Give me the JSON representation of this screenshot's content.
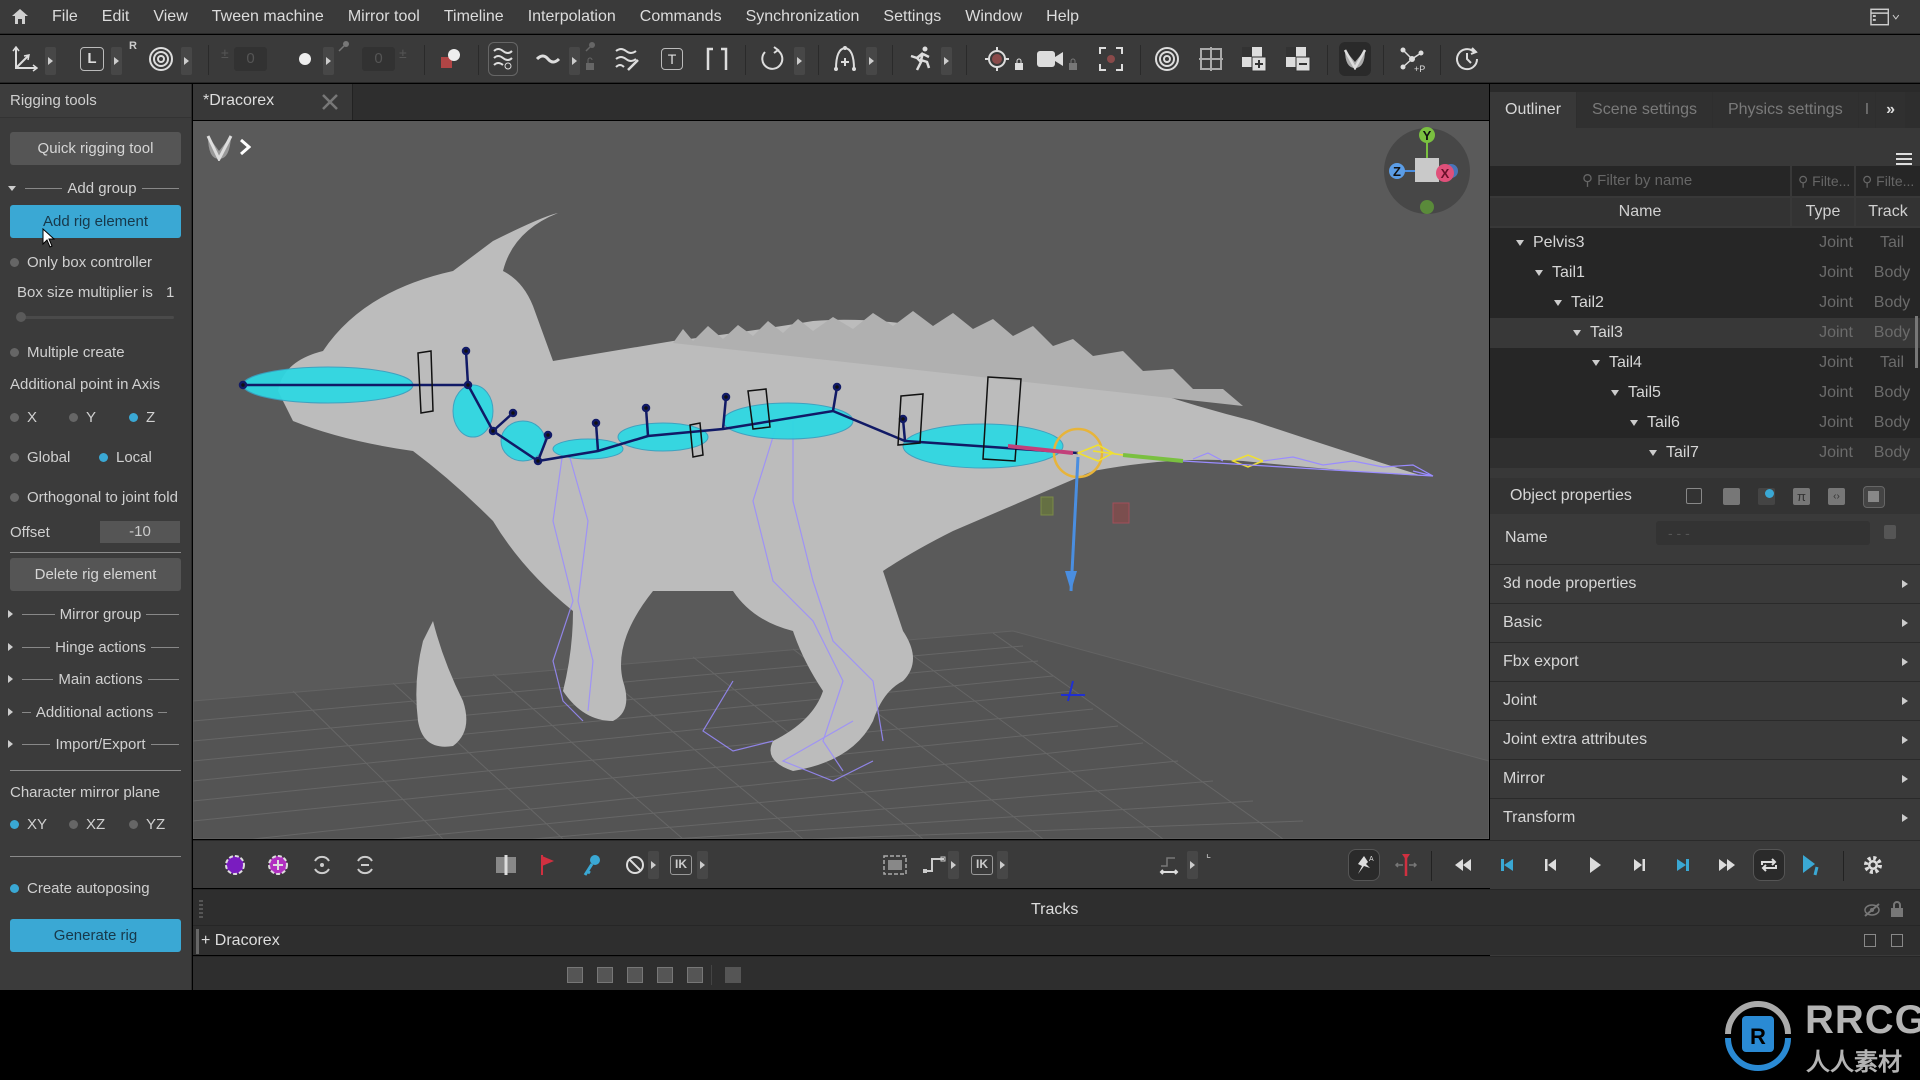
{
  "menubar": {
    "items": [
      "File",
      "Edit",
      "View",
      "Tween machine",
      "Mirror tool",
      "Timeline",
      "Interpolation",
      "Commands",
      "Synchronization",
      "Settings",
      "Window",
      "Help"
    ]
  },
  "toolbar": {
    "icons": [
      "axes-icon",
      "local-space-icon",
      "spiral-icon",
      "number-box",
      "dot-icon",
      "pin-icon",
      "number-box",
      "shapes-icon",
      "curves-icon",
      "wave-icon",
      "curves-edit-icon",
      "text-icon",
      "brackets-icon",
      "rotate-icon",
      "path-add-icon",
      "running-man-icon",
      "target-icon",
      "camera-icon",
      "frame-icon",
      "spiral-2-icon",
      "grid-icon",
      "layer-add-icon",
      "layer-remove-icon",
      "app-logo-icon",
      "nodes-icon",
      "history-icon"
    ],
    "local_label": "L",
    "r_label": "R",
    "num_left": "0",
    "num_right": "0"
  },
  "left_panel": {
    "title": "Rigging tools",
    "quick_rigging_tool": "Quick rigging tool",
    "add_group": "Add group",
    "add_rig_element": "Add rig element",
    "only_box_controller": "Only box controller",
    "box_size_label": "Box size multiplier is",
    "box_size_value": "1",
    "box_size_slider_fraction": 0.0,
    "multiple_create": "Multiple create",
    "additional_point_label": "Additional point in Axis",
    "axis_options": [
      {
        "label": "X",
        "selected": false
      },
      {
        "label": "Y",
        "selected": false
      },
      {
        "label": "Z",
        "selected": true
      }
    ],
    "space_options": [
      {
        "label": "Global",
        "selected": false
      },
      {
        "label": "Local",
        "selected": true
      }
    ],
    "orthogonal": "Orthogonal to joint fold",
    "offset_label": "Offset",
    "offset_value": "-10",
    "delete_rig_element": "Delete rig element",
    "groups": [
      "Mirror group",
      "Hinge actions",
      "Main actions",
      "Additional actions",
      "Import/Export"
    ],
    "mirror_plane_label": "Character mirror plane",
    "mirror_plane_options": [
      {
        "label": "XY",
        "selected": true
      },
      {
        "label": "XZ",
        "selected": false
      },
      {
        "label": "YZ",
        "selected": false
      }
    ],
    "create_autoposing": "Create autoposing",
    "create_autoposing_on": true,
    "generate_rig": "Generate rig"
  },
  "document": {
    "tab_title": "*Dracorex"
  },
  "viewport": {
    "gizmo": {
      "y": "Y",
      "x": "X",
      "z": "Z"
    }
  },
  "right_panel": {
    "tabs": [
      "Outliner",
      "Scene settings",
      "Physics settings",
      "I"
    ],
    "active_tab": "Outliner",
    "filters": {
      "name_placeholder": "Filter by name",
      "type_placeholder": "Filte...",
      "track_placeholder": "Filte..."
    },
    "columns": [
      "Name",
      "Type",
      "Track"
    ],
    "rows": [
      {
        "name": "Pelvis3",
        "type": "Joint",
        "track": "Tail"
      },
      {
        "name": "Tail1",
        "type": "Joint",
        "track": "Body"
      },
      {
        "name": "Tail2",
        "type": "Joint",
        "track": "Body"
      },
      {
        "name": "Tail3",
        "type": "Joint",
        "track": "Body"
      },
      {
        "name": "Tail4",
        "type": "Joint",
        "track": "Tail"
      },
      {
        "name": "Tail5",
        "type": "Joint",
        "track": "Body"
      },
      {
        "name": "Tail6",
        "type": "Joint",
        "track": "Body"
      },
      {
        "name": "Tail7",
        "type": "Joint",
        "track": "Body"
      }
    ],
    "object_properties": {
      "title": "Object properties",
      "name_label": "Name",
      "name_value": "- - -",
      "sections": [
        "3d  node  properties",
        "Basic",
        "Fbx export",
        "Joint",
        "Joint extra attributes",
        "Mirror",
        "Transform"
      ]
    }
  },
  "timeline": {
    "tracks_label": "Tracks",
    "track_item": "+ Dracorex",
    "ik_label": "IK"
  },
  "watermark": {
    "brand": "RRCG",
    "sub": "人人素材"
  },
  "colors": {
    "accent": "#3aa8d4",
    "panel": "#3b3b3b",
    "viewport": "#5a5a5a"
  }
}
